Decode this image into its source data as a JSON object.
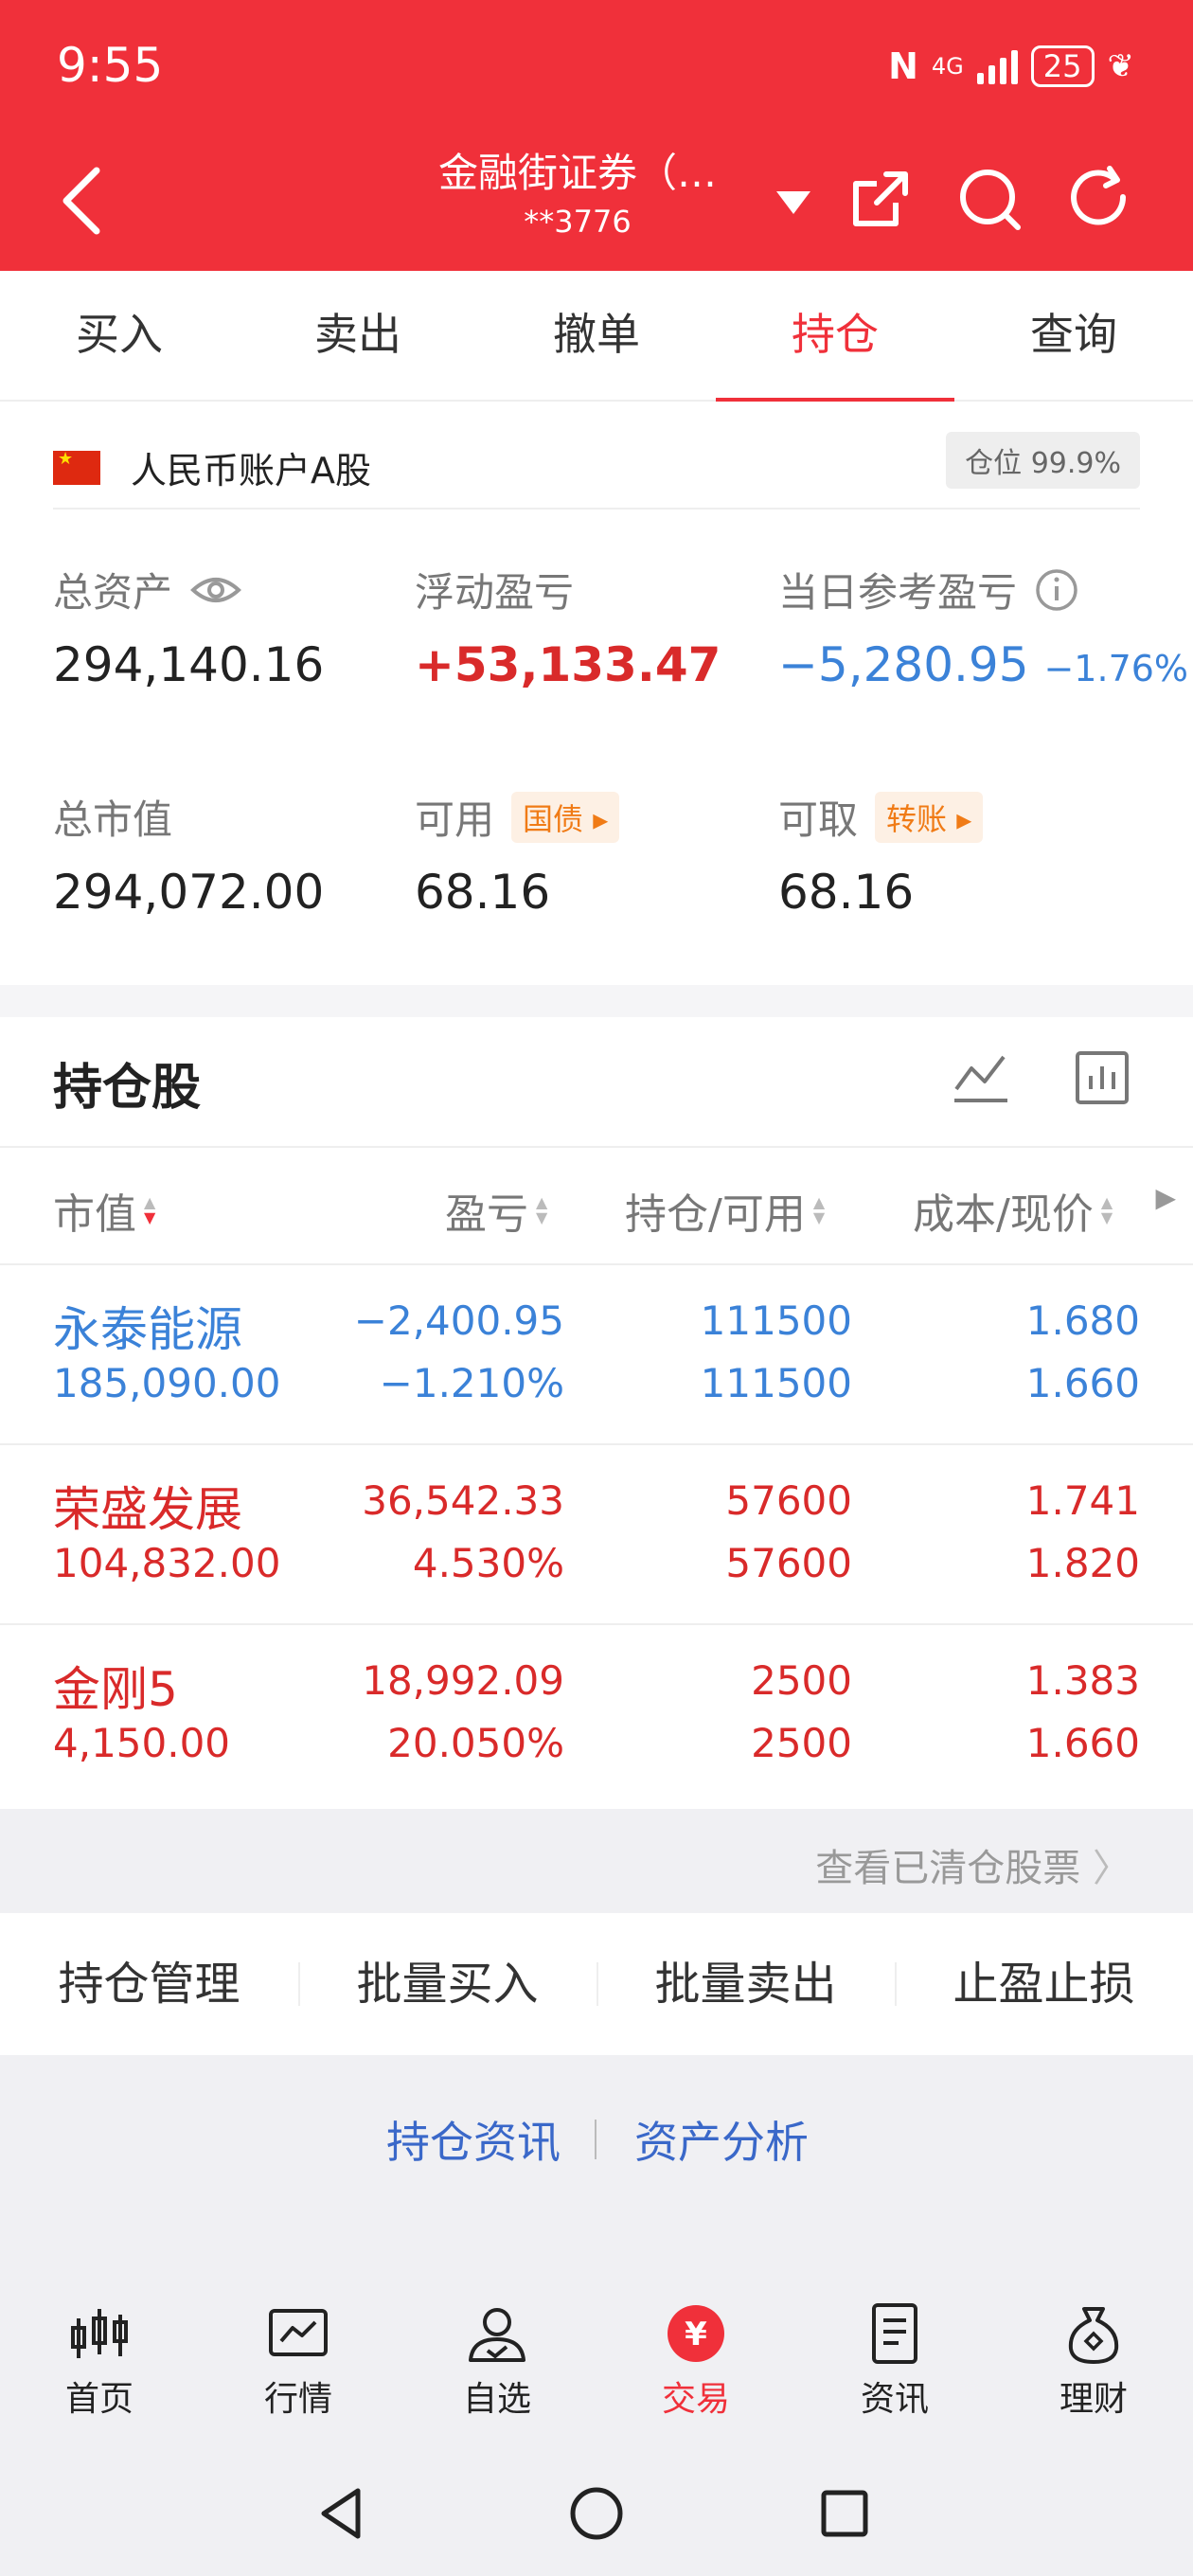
{
  "status_bar": {
    "time": "9:55",
    "network": "4G",
    "battery": "25"
  },
  "header": {
    "title": "金融街证券（…",
    "account_mask": "**3776"
  },
  "tabs": [
    {
      "label": "买入",
      "active": false
    },
    {
      "label": "卖出",
      "active": false
    },
    {
      "label": "撤单",
      "active": false
    },
    {
      "label": "持仓",
      "active": true
    },
    {
      "label": "查询",
      "active": false
    }
  ],
  "account": {
    "name": "人民币账户A股",
    "position_label": "仓位 99.9%",
    "total_assets_label": "总资产",
    "total_assets": "294,140.16",
    "floating_pl_label": "浮动盈亏",
    "floating_pl": "+53,133.47",
    "daily_pl_label": "当日参考盈亏",
    "daily_pl": "−5,280.95",
    "daily_pl_pct": "−1.76%",
    "market_value_label": "总市值",
    "market_value": "294,072.00",
    "available_label": "可用",
    "available_tag": "国债",
    "available": "68.16",
    "withdrawable_label": "可取",
    "withdrawable_tag": "转账",
    "withdrawable": "68.16"
  },
  "holdings": {
    "title": "持仓股",
    "columns": {
      "market_value": "市值",
      "pl": "盈亏",
      "position": "持仓/可用",
      "cost": "成本/现价"
    },
    "rows": [
      {
        "name": "永泰能源",
        "market_value": "185,090.00",
        "pl": "−2,400.95",
        "pl_pct": "−1.210%",
        "position": "111500",
        "available": "111500",
        "cost": "1.680",
        "price": "1.660",
        "trend": "down"
      },
      {
        "name": "荣盛发展",
        "market_value": "104,832.00",
        "pl": "36,542.33",
        "pl_pct": "4.530%",
        "position": "57600",
        "available": "57600",
        "cost": "1.741",
        "price": "1.820",
        "trend": "up"
      },
      {
        "name": "金刚5",
        "market_value": "4,150.00",
        "pl": "18,992.09",
        "pl_pct": "20.050%",
        "position": "2500",
        "available": "2500",
        "cost": "1.383",
        "price": "1.660",
        "trend": "up"
      }
    ],
    "cleared_link": "查看已清仓股票"
  },
  "actions": [
    "持仓管理",
    "批量买入",
    "批量卖出",
    "止盈止损"
  ],
  "links": [
    "持仓资讯",
    "资产分析"
  ],
  "bottom_nav": [
    {
      "label": "首页",
      "icon": "candlestick-icon",
      "active": false
    },
    {
      "label": "行情",
      "icon": "trend-chart-icon",
      "active": false
    },
    {
      "label": "自选",
      "icon": "user-check-icon",
      "active": false
    },
    {
      "label": "交易",
      "icon": "yuan-icon",
      "active": true
    },
    {
      "label": "资讯",
      "icon": "document-icon",
      "active": false
    },
    {
      "label": "理财",
      "icon": "money-bag-icon",
      "active": false
    }
  ],
  "colors": {
    "brand_red": "#f0303a",
    "gain_red": "#d92a2a",
    "loss_blue": "#3b82d8",
    "tag_orange": "#f07b16",
    "link_blue": "#3a68c9"
  }
}
